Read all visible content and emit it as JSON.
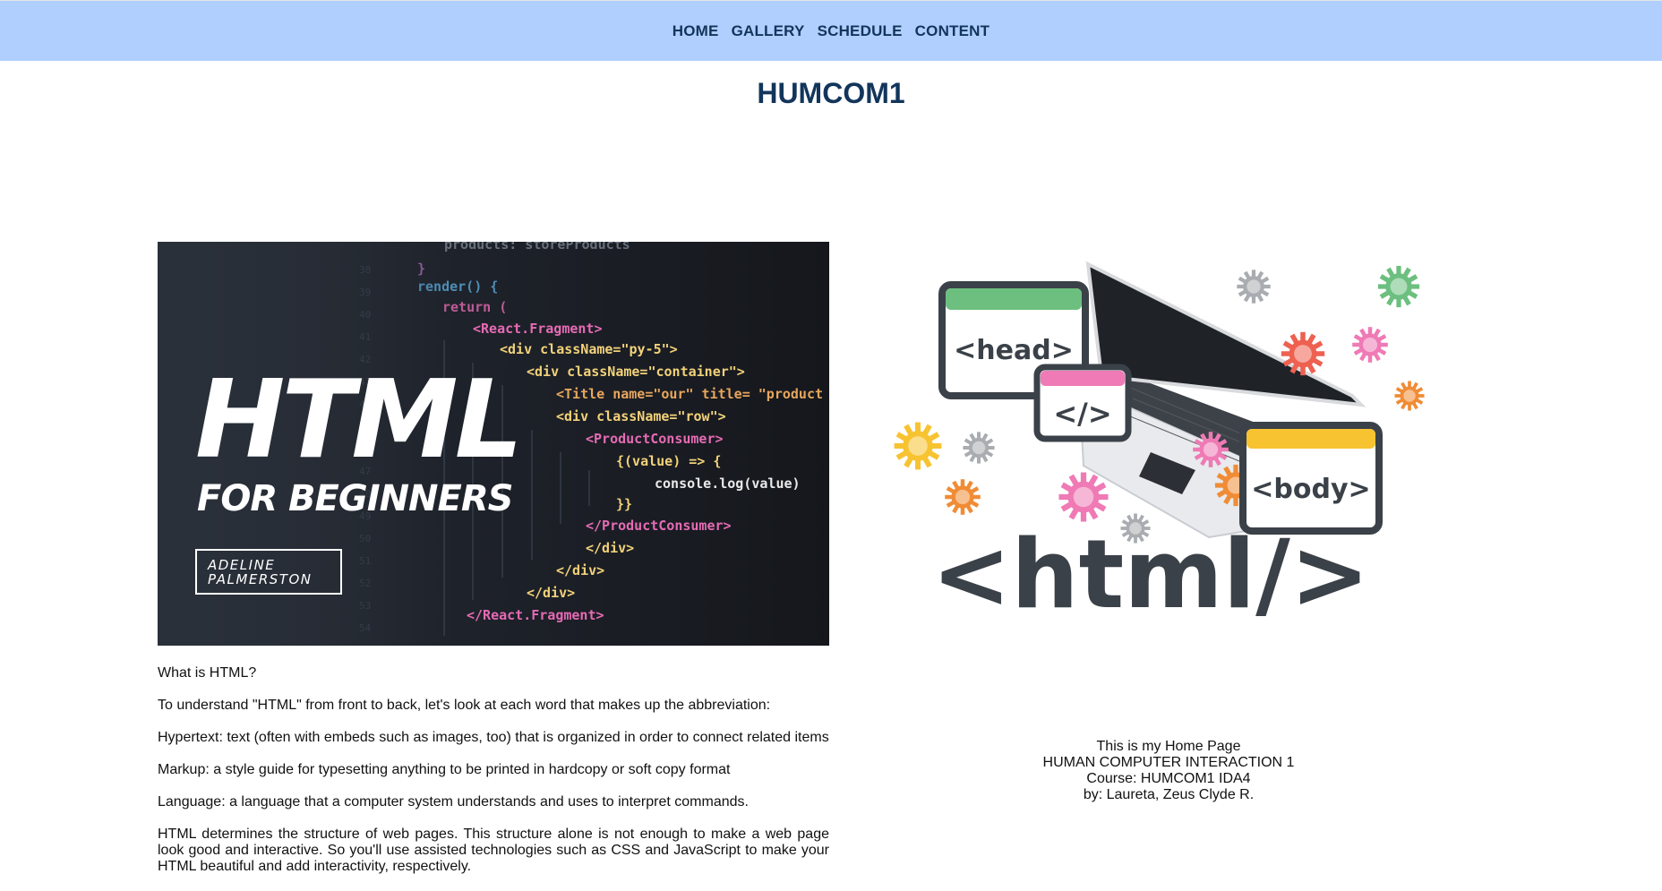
{
  "nav": {
    "items": [
      "HOME",
      "GALLERY",
      "SCHEDULE",
      "CONTENT"
    ]
  },
  "page_title": "HUMCOM1",
  "hero": {
    "title": "HTML",
    "subtitle": "FOR BEGINNERS",
    "author_line1": "ADELINE",
    "author_line2": "PALMERSTON",
    "code_lines": [
      "products: storeProducts",
      "}",
      "render() {",
      "return (",
      "<React.Fragment>",
      "<div className=\"py-5\">",
      "<div className=\"container\">",
      "<Title name=\"our\" title= \"product",
      "<div className=\"row\">",
      "<ProductConsumer>",
      "{(value) => {",
      "console.log(value)",
      "}}",
      "</ProductConsumer>",
      "</div>",
      "</div>",
      "</div>",
      "</React.Fragment>"
    ]
  },
  "illustration": {
    "head_label": "<head>",
    "slash_label": "</>",
    "body_label": "<body>",
    "html_label": "<html/>"
  },
  "content": {
    "paragraphs": [
      "What is HTML?",
      "To understand \"HTML\" from front to back, let's look at each word that makes up the abbreviation:",
      "Hypertext: text (often with embeds such as images, too) that is organized in order to connect related items",
      "Markup: a style guide for typesetting anything to be printed in hardcopy or soft copy format",
      "Language: a language that a computer system understands and uses to interpret commands.",
      "HTML determines the structure of web pages. This structure alone is not enough to make a web page look good and interactive. So you'll use assisted technologies such as CSS and JavaScript to make your HTML beautiful and add interactivity, respectively."
    ]
  },
  "footer": {
    "lines": [
      "This is my Home Page",
      "HUMAN COMPUTER INTERACTION 1",
      "Course: HUMCOM1 IDA4",
      "by: Laureta, Zeus Clyde R."
    ]
  },
  "colors": {
    "nav_bg": "#b0cffe",
    "nav_text": "#12355b",
    "title": "#12355b",
    "hero_bg": "#1f232b",
    "green": "#6dbf80",
    "pink": "#ef7ab5",
    "yellow": "#f7c331",
    "orange": "#f08c36",
    "red": "#ee6150",
    "dark": "#3b4148"
  }
}
